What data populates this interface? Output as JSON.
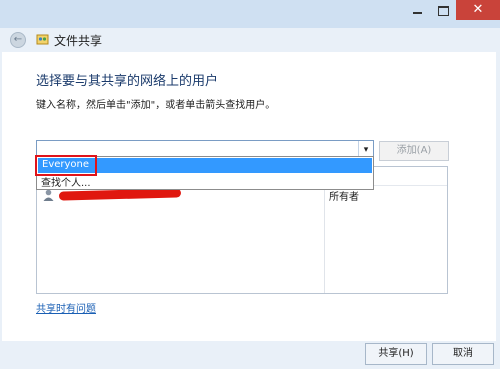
{
  "window": {
    "title": "文件共享",
    "close_glyph": "✕"
  },
  "nav": {
    "back_glyph": "←"
  },
  "main": {
    "heading": "选择要与其共享的网络上的用户",
    "instructions": "键入名称，然后单击\"添加\"，或者单击箭头查找用户。",
    "combo_value": "",
    "combo_arrow_glyph": "▾",
    "add_button": "添加(A)",
    "dropdown_options": [
      "Everyone",
      "查找个人..."
    ],
    "selected_option": "Everyone",
    "permission_list": {
      "rows": [
        {
          "name": "",
          "permission": "所有者"
        }
      ]
    },
    "help_link": "共享时有问题"
  },
  "footer": {
    "share_button": "共享(H)",
    "cancel_button": "取消"
  },
  "colors": {
    "selection": "#3399ff",
    "highlight_box": "#e0131a",
    "close_button": "#c9433a",
    "heading": "#1a3a6b",
    "link": "#1a5fb4"
  }
}
